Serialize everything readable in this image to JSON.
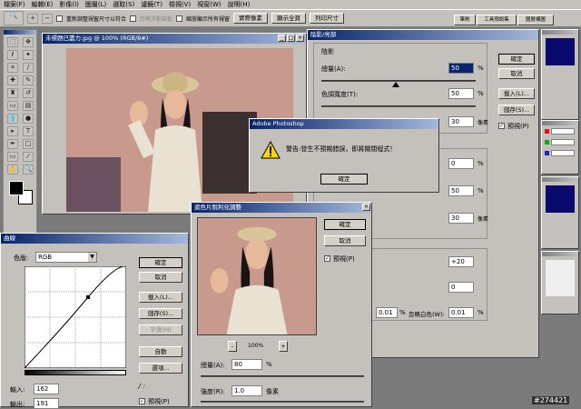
{
  "menu": [
    "檔案(F)",
    "編輯(E)",
    "影像(I)",
    "圖層(L)",
    "選取(S)",
    "濾鏡(T)",
    "檢視(V)",
    "視窗(W)",
    "說明(H)"
  ],
  "options": {
    "chk1": "重新調整視窗尺寸以符合",
    "chk2": "忽略浮動調板",
    "chk3": "縮放顯示所有視窗",
    "btn1": "實際像素",
    "btn2": "顯示全頁",
    "btn3": "列印尺寸"
  },
  "palette_tabs": [
    "筆刷",
    "工具預設集",
    "圖層構圖"
  ],
  "doc": {
    "title": "未標題已盡力.jpg @ 100% (RGB/8#)"
  },
  "hue": {
    "title": "陰影/亮部",
    "section": "陰影",
    "amount_label": "總量(A):",
    "amount": "50",
    "pct": "%",
    "tone_label": "色調寬度(T):",
    "tone": "50",
    "pct2": "%",
    "radius": "30",
    "px": "像素",
    "hl1": "0",
    "hl2": "50",
    "hl3": "30",
    "pct3": "%",
    "pct4": "%",
    "px2": "像素",
    "adj1": "+20",
    "adj2": "0",
    "black": "0.01",
    "black_pct": "%",
    "white_label": "忽略白色(W):",
    "white": "0.01",
    "white_pct": "%",
    "ok": "確定",
    "cancel": "取消",
    "load": "載入(L)...",
    "save": "儲存(S)...",
    "preview": "預視(P)"
  },
  "alert": {
    "title": "Adobe Photoshop",
    "message": "警告:發生不預期錯誤，即將關閉程式！",
    "ok": "確定"
  },
  "sharpen": {
    "title": "遮色片銳利化調整",
    "ok": "確定",
    "cancel": "取消",
    "preview": "預視(P)",
    "zoom": "100%",
    "minus": "-",
    "plus": "+",
    "amount_label": "總量(A):",
    "amount": "80",
    "pct": "%",
    "radius_label": "強度(R):",
    "radius": "1.0",
    "px": "像素"
  },
  "curves": {
    "title": "曲線",
    "channel_label": "色版:",
    "channel": "RGB",
    "input_label": "輸入:",
    "input": "162",
    "output_label": "輸出:",
    "output": "191",
    "ok": "確定",
    "cancel": "取消",
    "load": "載入(L)...",
    "save": "儲存(S)...",
    "smooth": "平滑(M)",
    "auto": "自動",
    "options": "選項...",
    "preview": "預視(P)"
  },
  "watermark": "#274421"
}
